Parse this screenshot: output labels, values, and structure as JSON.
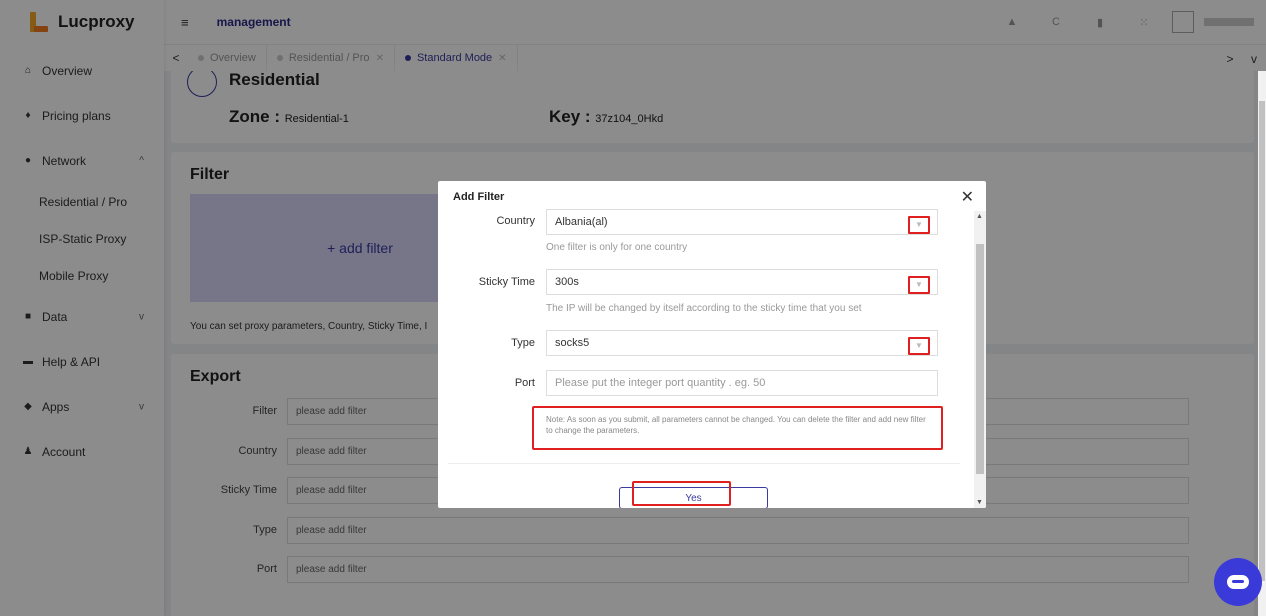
{
  "sidebar": {
    "logo": "Lucproxy",
    "items": [
      {
        "label": "Overview",
        "icon": "home-icon",
        "glyph": "⌂"
      },
      {
        "label": "Pricing plans",
        "icon": "money-bag-icon",
        "glyph": "♦"
      },
      {
        "label": "Network",
        "icon": "globe-icon",
        "glyph": "●",
        "chevron": "^"
      },
      {
        "label": "Data",
        "icon": "calendar-icon",
        "glyph": "■",
        "chevron": "v"
      },
      {
        "label": "Help & API",
        "icon": "card-icon",
        "glyph": "▬"
      },
      {
        "label": "Apps",
        "icon": "cube-icon",
        "glyph": "◆",
        "chevron": "v"
      },
      {
        "label": "Account",
        "icon": "user-icon",
        "glyph": "♟"
      }
    ],
    "network_sub": [
      "Residential / Pro",
      "ISP-Static Proxy",
      "Mobile Proxy"
    ]
  },
  "header": {
    "title": "management",
    "menu_glyph": "≡",
    "icons": [
      "bell-icon",
      "refresh-icon",
      "trash-icon",
      "fullscreen-icon"
    ]
  },
  "tabs": {
    "prev": "<",
    "next": ">",
    "dropdown": "v",
    "items": [
      {
        "label": "Overview",
        "active": false,
        "closable": false
      },
      {
        "label": "Residential / Pro",
        "active": false,
        "closable": true
      },
      {
        "label": "Standard Mode",
        "active": true,
        "closable": true
      }
    ]
  },
  "main": {
    "card_title": "Residential",
    "zone_label": "Zone : ",
    "zone_value": "Residential-1",
    "key_label": "Key : ",
    "key_value": "37z104_0Hkd",
    "filter_title": "Filter",
    "add_filter": "+ add filter",
    "filter_hint": "You can set proxy parameters, Country, Sticky Time, I",
    "export_title": "Export",
    "export_rows": [
      {
        "label": "Filter",
        "value": "please add filter"
      },
      {
        "label": "Country",
        "value": "please add filter"
      },
      {
        "label": "Sticky Time",
        "value": "please add filter"
      },
      {
        "label": "Type",
        "value": "please add filter"
      },
      {
        "label": "Port",
        "value": "please add filter"
      }
    ]
  },
  "modal": {
    "title": "Add Filter",
    "close": "✕",
    "country_label": "Country",
    "country_value": "Albania(al)",
    "country_help": "One filter is only for one country",
    "sticky_label": "Sticky Time",
    "sticky_value": "300s",
    "sticky_help": "The IP will be changed by itself according to the sticky time that you set",
    "type_label": "Type",
    "type_value": "socks5",
    "port_label": "Port",
    "port_placeholder": "Please put the integer port quantity . eg. 50",
    "note": "Note: As soon as you submit, all parameters cannot be changed. You can delete the filter and add new filter to change the parameters.",
    "yes": "Yes"
  },
  "colors": {
    "accent": "#3a3aa0",
    "highlight": "#e02020",
    "chat": "#3a3ad8"
  }
}
